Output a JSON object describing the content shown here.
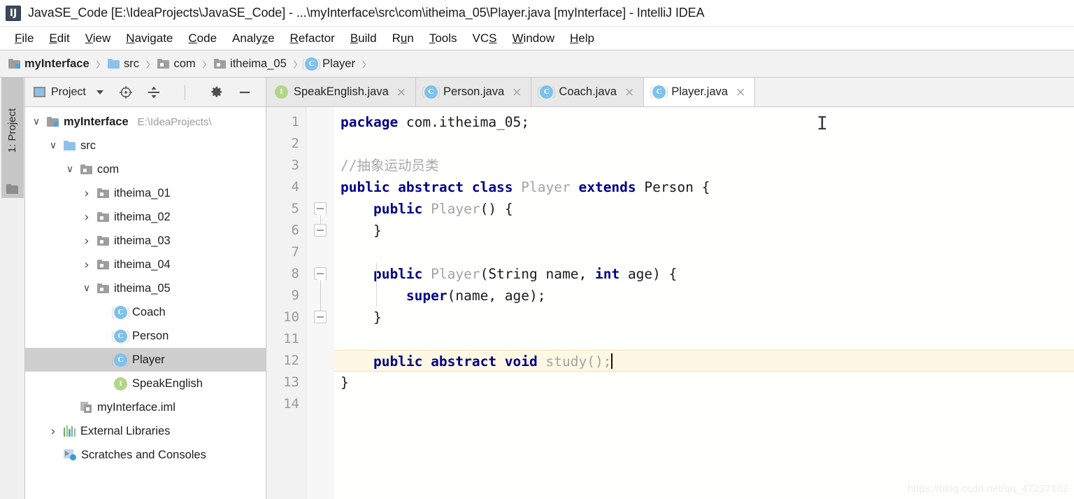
{
  "window": {
    "app_icon": "intellij-idea-icon",
    "title": "JavaSE_Code [E:\\IdeaProjects\\JavaSE_Code] - ...\\myInterface\\src\\com\\itheima_05\\Player.java [myInterface] - IntelliJ IDEA"
  },
  "menubar": {
    "items": [
      {
        "label": "File",
        "mnemonic": "F"
      },
      {
        "label": "Edit",
        "mnemonic": "E"
      },
      {
        "label": "View",
        "mnemonic": "V"
      },
      {
        "label": "Navigate",
        "mnemonic": "N"
      },
      {
        "label": "Code",
        "mnemonic": "C"
      },
      {
        "label": "Analyze",
        "mnemonic": "z"
      },
      {
        "label": "Refactor",
        "mnemonic": "R"
      },
      {
        "label": "Build",
        "mnemonic": "B"
      },
      {
        "label": "Run",
        "mnemonic": "u"
      },
      {
        "label": "Tools",
        "mnemonic": "T"
      },
      {
        "label": "VCS",
        "mnemonic": "S"
      },
      {
        "label": "Window",
        "mnemonic": "W"
      },
      {
        "label": "Help",
        "mnemonic": "H"
      }
    ]
  },
  "breadcrumb": {
    "separator": "›",
    "items": [
      {
        "label": "myInterface",
        "icon": "module-icon",
        "bold": true
      },
      {
        "label": "src",
        "icon": "source-folder-icon",
        "bold": false
      },
      {
        "label": "com",
        "icon": "folder-icon",
        "bold": false
      },
      {
        "label": "itheima_05",
        "icon": "folder-icon",
        "bold": false
      },
      {
        "label": "Player",
        "icon": "class-icon",
        "bold": false
      }
    ]
  },
  "tool_window_strip": {
    "tab_number": "1",
    "tab_label": ": Project",
    "tab_full": "1: Project",
    "folder_icon": "folder-icon"
  },
  "project_panel": {
    "toolbar": {
      "title": "Project",
      "caret_icon": "chevron-down-icon",
      "buttons": [
        {
          "name": "locate-icon",
          "glyph": "⊕"
        },
        {
          "name": "collapse-all-icon",
          "glyph": "≡"
        },
        {
          "name": "settings-gear-icon",
          "glyph": "⚙"
        },
        {
          "name": "hide-icon",
          "glyph": "—"
        }
      ]
    },
    "tree": [
      {
        "label": "myInterface",
        "sub": "E:\\IdeaProjects\\",
        "icon": "module-icon",
        "arrow": "expanded",
        "indent": 0,
        "bold": true,
        "selected": false
      },
      {
        "label": "src",
        "sub": "",
        "icon": "source-folder-icon",
        "arrow": "expanded",
        "indent": 1,
        "bold": false,
        "selected": false
      },
      {
        "label": "com",
        "sub": "",
        "icon": "folder-icon",
        "arrow": "expanded",
        "indent": 2,
        "bold": false,
        "selected": false
      },
      {
        "label": "itheima_01",
        "sub": "",
        "icon": "folder-icon",
        "arrow": "collapsed",
        "indent": 3,
        "bold": false,
        "selected": false
      },
      {
        "label": "itheima_02",
        "sub": "",
        "icon": "folder-icon",
        "arrow": "collapsed",
        "indent": 3,
        "bold": false,
        "selected": false
      },
      {
        "label": "itheima_03",
        "sub": "",
        "icon": "folder-icon",
        "arrow": "collapsed",
        "indent": 3,
        "bold": false,
        "selected": false
      },
      {
        "label": "itheima_04",
        "sub": "",
        "icon": "folder-icon",
        "arrow": "collapsed",
        "indent": 3,
        "bold": false,
        "selected": false
      },
      {
        "label": "itheima_05",
        "sub": "",
        "icon": "folder-icon",
        "arrow": "expanded",
        "indent": 3,
        "bold": false,
        "selected": false
      },
      {
        "label": "Coach",
        "sub": "",
        "icon": "class-icon",
        "arrow": "none",
        "indent": 4,
        "bold": false,
        "selected": false
      },
      {
        "label": "Person",
        "sub": "",
        "icon": "class-icon",
        "arrow": "none",
        "indent": 4,
        "bold": false,
        "selected": false
      },
      {
        "label": "Player",
        "sub": "",
        "icon": "class-icon",
        "arrow": "none",
        "indent": 4,
        "bold": false,
        "selected": true
      },
      {
        "label": "SpeakEnglish",
        "sub": "",
        "icon": "interface-icon",
        "arrow": "none",
        "indent": 4,
        "bold": false,
        "selected": false
      },
      {
        "label": "myInterface.iml",
        "sub": "",
        "icon": "iml-file-icon",
        "arrow": "none",
        "indent": 2,
        "bold": false,
        "selected": false
      },
      {
        "label": "External Libraries",
        "sub": "",
        "icon": "library-icon",
        "arrow": "collapsed",
        "indent": 1,
        "bold": false,
        "selected": false
      },
      {
        "label": "Scratches and Consoles",
        "sub": "",
        "icon": "scratches-icon",
        "arrow": "none",
        "indent": 1,
        "bold": false,
        "selected": false
      }
    ]
  },
  "editor": {
    "tabs": [
      {
        "label": "SpeakEnglish.java",
        "icon": "interface-icon",
        "active": false,
        "close": "×"
      },
      {
        "label": "Person.java",
        "icon": "class-icon",
        "active": false,
        "close": "×"
      },
      {
        "label": "Coach.java",
        "icon": "class-icon",
        "active": false,
        "close": "×"
      },
      {
        "label": "Player.java",
        "icon": "class-icon",
        "active": true,
        "close": "×"
      }
    ],
    "line_numbers": [
      "1",
      "2",
      "3",
      "4",
      "5",
      "6",
      "7",
      "8",
      "9",
      "10",
      "11",
      "12",
      "13",
      "14"
    ],
    "current_line": 12,
    "lines": [
      {
        "n": 1,
        "tokens": [
          {
            "t": "package ",
            "c": "kw"
          },
          {
            "t": "com.itheima_05;",
            "c": "plain"
          }
        ]
      },
      {
        "n": 2,
        "tokens": []
      },
      {
        "n": 3,
        "tokens": [
          {
            "t": "//抽象运动员类",
            "c": "cmt"
          }
        ]
      },
      {
        "n": 4,
        "tokens": [
          {
            "t": "public abstract class ",
            "c": "kw"
          },
          {
            "t": "Player ",
            "c": "dim"
          },
          {
            "t": "extends ",
            "c": "kw"
          },
          {
            "t": "Person {",
            "c": "plain"
          }
        ]
      },
      {
        "n": 5,
        "tokens": [
          {
            "t": "    public ",
            "c": "kw"
          },
          {
            "t": "Player",
            "c": "dim"
          },
          {
            "t": "() {",
            "c": "plain"
          }
        ]
      },
      {
        "n": 6,
        "tokens": [
          {
            "t": "    }",
            "c": "plain"
          }
        ]
      },
      {
        "n": 7,
        "tokens": []
      },
      {
        "n": 8,
        "tokens": [
          {
            "t": "    public ",
            "c": "kw"
          },
          {
            "t": "Player",
            "c": "dim"
          },
          {
            "t": "(String name, ",
            "c": "plain"
          },
          {
            "t": "int ",
            "c": "kw"
          },
          {
            "t": "age) {",
            "c": "plain"
          }
        ]
      },
      {
        "n": 9,
        "tokens": [
          {
            "t": "        super",
            "c": "kw"
          },
          {
            "t": "(name, age);",
            "c": "plain"
          }
        ]
      },
      {
        "n": 10,
        "tokens": [
          {
            "t": "    }",
            "c": "plain"
          }
        ]
      },
      {
        "n": 11,
        "tokens": []
      },
      {
        "n": 12,
        "tokens": [
          {
            "t": "    public abstract void ",
            "c": "kw"
          },
          {
            "t": "study();",
            "c": "dim"
          }
        ]
      },
      {
        "n": 13,
        "tokens": [
          {
            "t": "}",
            "c": "plain"
          }
        ]
      },
      {
        "n": 14,
        "tokens": []
      }
    ],
    "fold_markers": [
      {
        "line": 5,
        "type": "down"
      },
      {
        "line": 6,
        "type": "up"
      },
      {
        "line": 8,
        "type": "down"
      },
      {
        "line": 10,
        "type": "up"
      }
    ],
    "mouse_cursor": "text-cursor-icon"
  },
  "watermark": {
    "text": "https://blog.csdn.net/qq_47237102"
  },
  "colors": {
    "keyword": "#000087",
    "dim_identifier": "#a3a3a3",
    "comment": "#a8a8a8",
    "selection": "#cfcfcf",
    "current_line": "#fdf8e3",
    "class_icon": "#7ec1ea",
    "interface_icon": "#b3d58a",
    "source_folder": "#8cc2e8"
  }
}
